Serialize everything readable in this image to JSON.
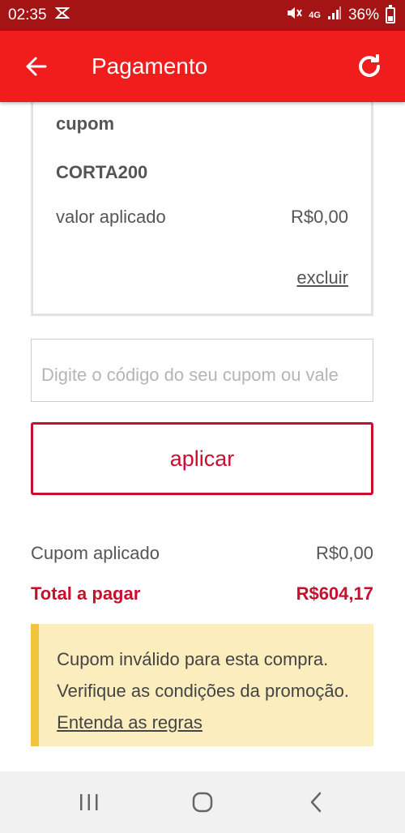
{
  "status_bar": {
    "time": "02:35",
    "battery_pct": "36%",
    "network": "4G"
  },
  "app_bar": {
    "title": "Pagamento"
  },
  "coupon_card": {
    "label": "cupom",
    "code": "CORTA200",
    "applied_label": "valor aplicado",
    "applied_value": "R$0,00",
    "remove_label": "excluir"
  },
  "coupon_input": {
    "placeholder": "Digite o código do seu cupom ou vale",
    "value": ""
  },
  "apply_button": {
    "label": "aplicar"
  },
  "summary": {
    "coupon_label": "Cupom aplicado",
    "coupon_value": "R$0,00",
    "total_label": "Total a pagar",
    "total_value": "R$604,17"
  },
  "warning": {
    "message": "Cupom inválido para esta compra. Verifique as condições da promoção.",
    "link_label": "Entenda as regras"
  },
  "colors": {
    "status_bar": "#a41414",
    "app_bar": "#f11d1d",
    "accent": "#c8102e",
    "warning_bg": "#fbedbd",
    "warning_bar": "#f0c53b"
  }
}
